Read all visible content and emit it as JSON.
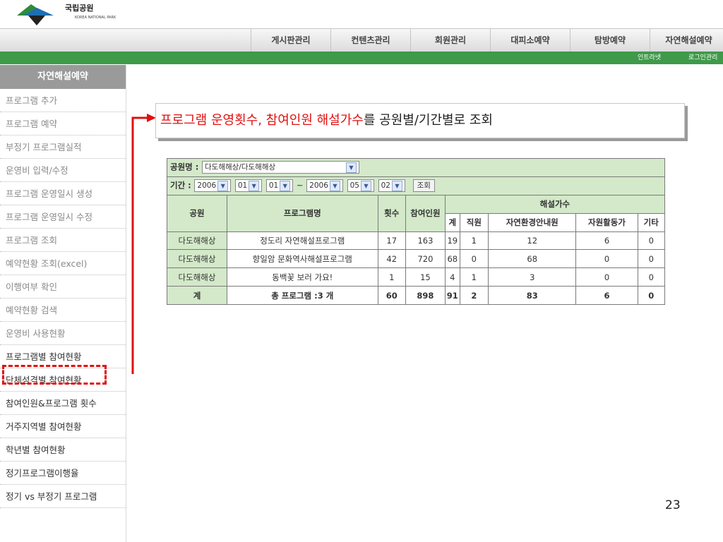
{
  "brand": {
    "name": "국립공원",
    "sub": "KOREA NATIONAL PARK"
  },
  "nav": {
    "items": [
      "게시판관리",
      "컨텐츠관리",
      "회원관리",
      "대피소예약",
      "탐방예약",
      "자연해설예약"
    ]
  },
  "util": {
    "intranet": "인트라넷",
    "logout": "로그인관리"
  },
  "sidebar": {
    "title": "자연해설예약",
    "items": [
      "프로그램 추가",
      "프로그램 예약",
      "부정기 프로그램실적",
      "운영비 입력/수정",
      "프로그램 운영일시 생성",
      "프로그램 운영일시 수정",
      "프로그램 조회",
      "예약현황 조회(excel)",
      "이행여부 확인",
      "예약현황 검색",
      "운영비 사용현황",
      "프로그램별 참여현황",
      "단체성격별 참여현황",
      "참여인원&프로그램 횟수",
      "거주지역별 참여현황",
      "학년별 참여현황",
      "정기프로그램이행율",
      "정기 vs 부정기 프로그램"
    ]
  },
  "callout": {
    "red": "프로그램 운영횟수, 참여인원 해설가수",
    "black": "를 공원별/기간별로 조회"
  },
  "filters": {
    "park_label": "공원명 :",
    "park_value": "다도해해상/다도해해상",
    "period_label": "기간 :",
    "from_year": "2006",
    "from_month": "01",
    "from_day": "01",
    "tilde": "~",
    "to_year": "2006",
    "to_month": "05",
    "to_day": "02",
    "search_button": "조회"
  },
  "table": {
    "headers": {
      "park": "공원",
      "program": "프로그램명",
      "count": "횟수",
      "participants": "참여인원",
      "guides": "해설가수",
      "total": "계",
      "staff": "직원",
      "nature_guide": "자연환경안내원",
      "volunteer": "자원활동가",
      "other": "기타"
    },
    "rows": [
      [
        "다도해해상",
        "정도리 자연해설프로그램",
        "17",
        "163",
        "19",
        "1",
        "12",
        "6",
        "0"
      ],
      [
        "다도해해상",
        "향일암 문화역사해설프로그램",
        "42",
        "720",
        "68",
        "0",
        "68",
        "0",
        "0"
      ],
      [
        "다도해해상",
        "동백꽃 보러 가요!",
        "1",
        "15",
        "4",
        "1",
        "3",
        "0",
        "0"
      ]
    ],
    "totals": [
      "계",
      "총 프로그램 :3 개",
      "60",
      "898",
      "91",
      "2",
      "83",
      "6",
      "0"
    ]
  },
  "page_number": "23",
  "colors": {
    "accent_red": "#e01010",
    "nav_green": "#3f9a4a",
    "table_green": "#d3e9c9",
    "sidebar_header": "#9a9a9a"
  }
}
